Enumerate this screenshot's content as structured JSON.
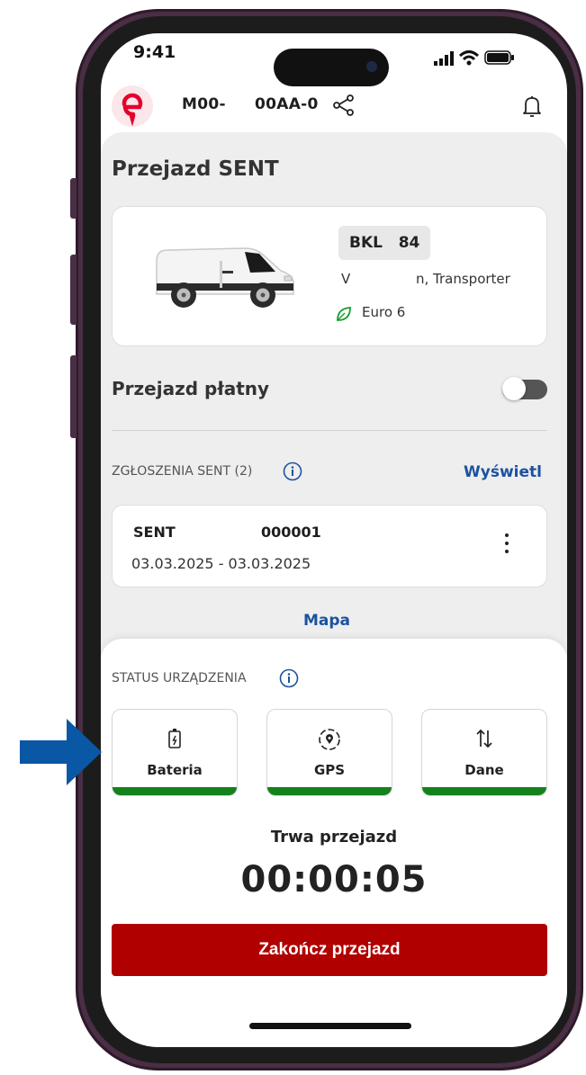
{
  "status_bar": {
    "time": "9:41"
  },
  "header": {
    "plate_part1": "M00-",
    "plate_part2": "00AA-0"
  },
  "page": {
    "title": "Przejazd SENT"
  },
  "vehicle": {
    "registration": "BKL   84",
    "model_left": "V",
    "model_right": "n, Transporter",
    "emission": "Euro 6"
  },
  "paid_ride": {
    "label": "Przejazd płatny",
    "enabled": false
  },
  "sent_section": {
    "header": "ZGŁOSZENIA SENT (2)",
    "show_link": "Wyświetl",
    "item": {
      "id_part1": "SENT",
      "id_part2": "000001",
      "dates": "03.03.2025 - 03.03.2025"
    },
    "map_link": "Mapa"
  },
  "device_status": {
    "header": "STATUS URZĄDZENIA",
    "tiles": [
      {
        "label": "Bateria",
        "icon": "battery-icon",
        "level": 1.0
      },
      {
        "label": "GPS",
        "icon": "gps-icon",
        "level": 1.0
      },
      {
        "label": "Dane",
        "icon": "data-transfer-icon",
        "level": 1.0
      }
    ]
  },
  "ride": {
    "status": "Trwa przejazd",
    "timer": "00:00:05",
    "end_button": "Zakończ przejazd"
  },
  "colors": {
    "accent_blue": "#1c52a0",
    "end_button": "#b00000",
    "status_ok": "#14821c",
    "arrow": "#0a57a6"
  }
}
